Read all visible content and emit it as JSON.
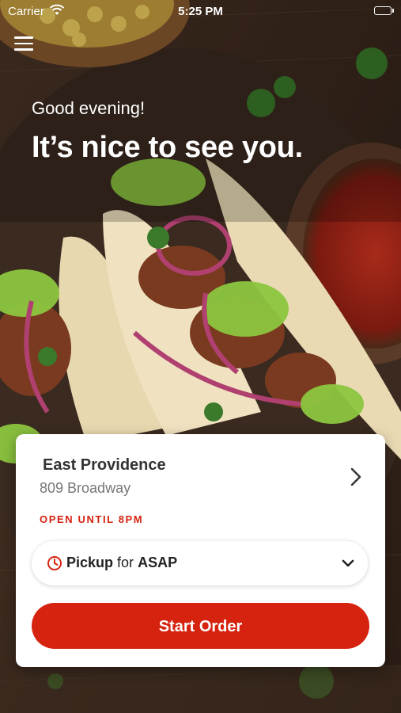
{
  "status_bar": {
    "carrier": "Carrier",
    "time": "5:25 PM"
  },
  "hero": {
    "greeting": "Good evening!",
    "headline": "It’s nice to see you."
  },
  "store": {
    "name": "East Providence",
    "address": "809 Broadway",
    "status": "OPEN UNTIL 8PM"
  },
  "order_type": {
    "mode": "Pickup",
    "connector": "for",
    "time": "ASAP"
  },
  "cta": {
    "label": "Start Order"
  },
  "colors": {
    "accent": "#d62310",
    "card": "#ffffff"
  },
  "icons": [
    "wifi-icon",
    "battery-icon",
    "menu-icon",
    "chevron-right-icon",
    "clock-icon",
    "chevron-down-icon"
  ]
}
